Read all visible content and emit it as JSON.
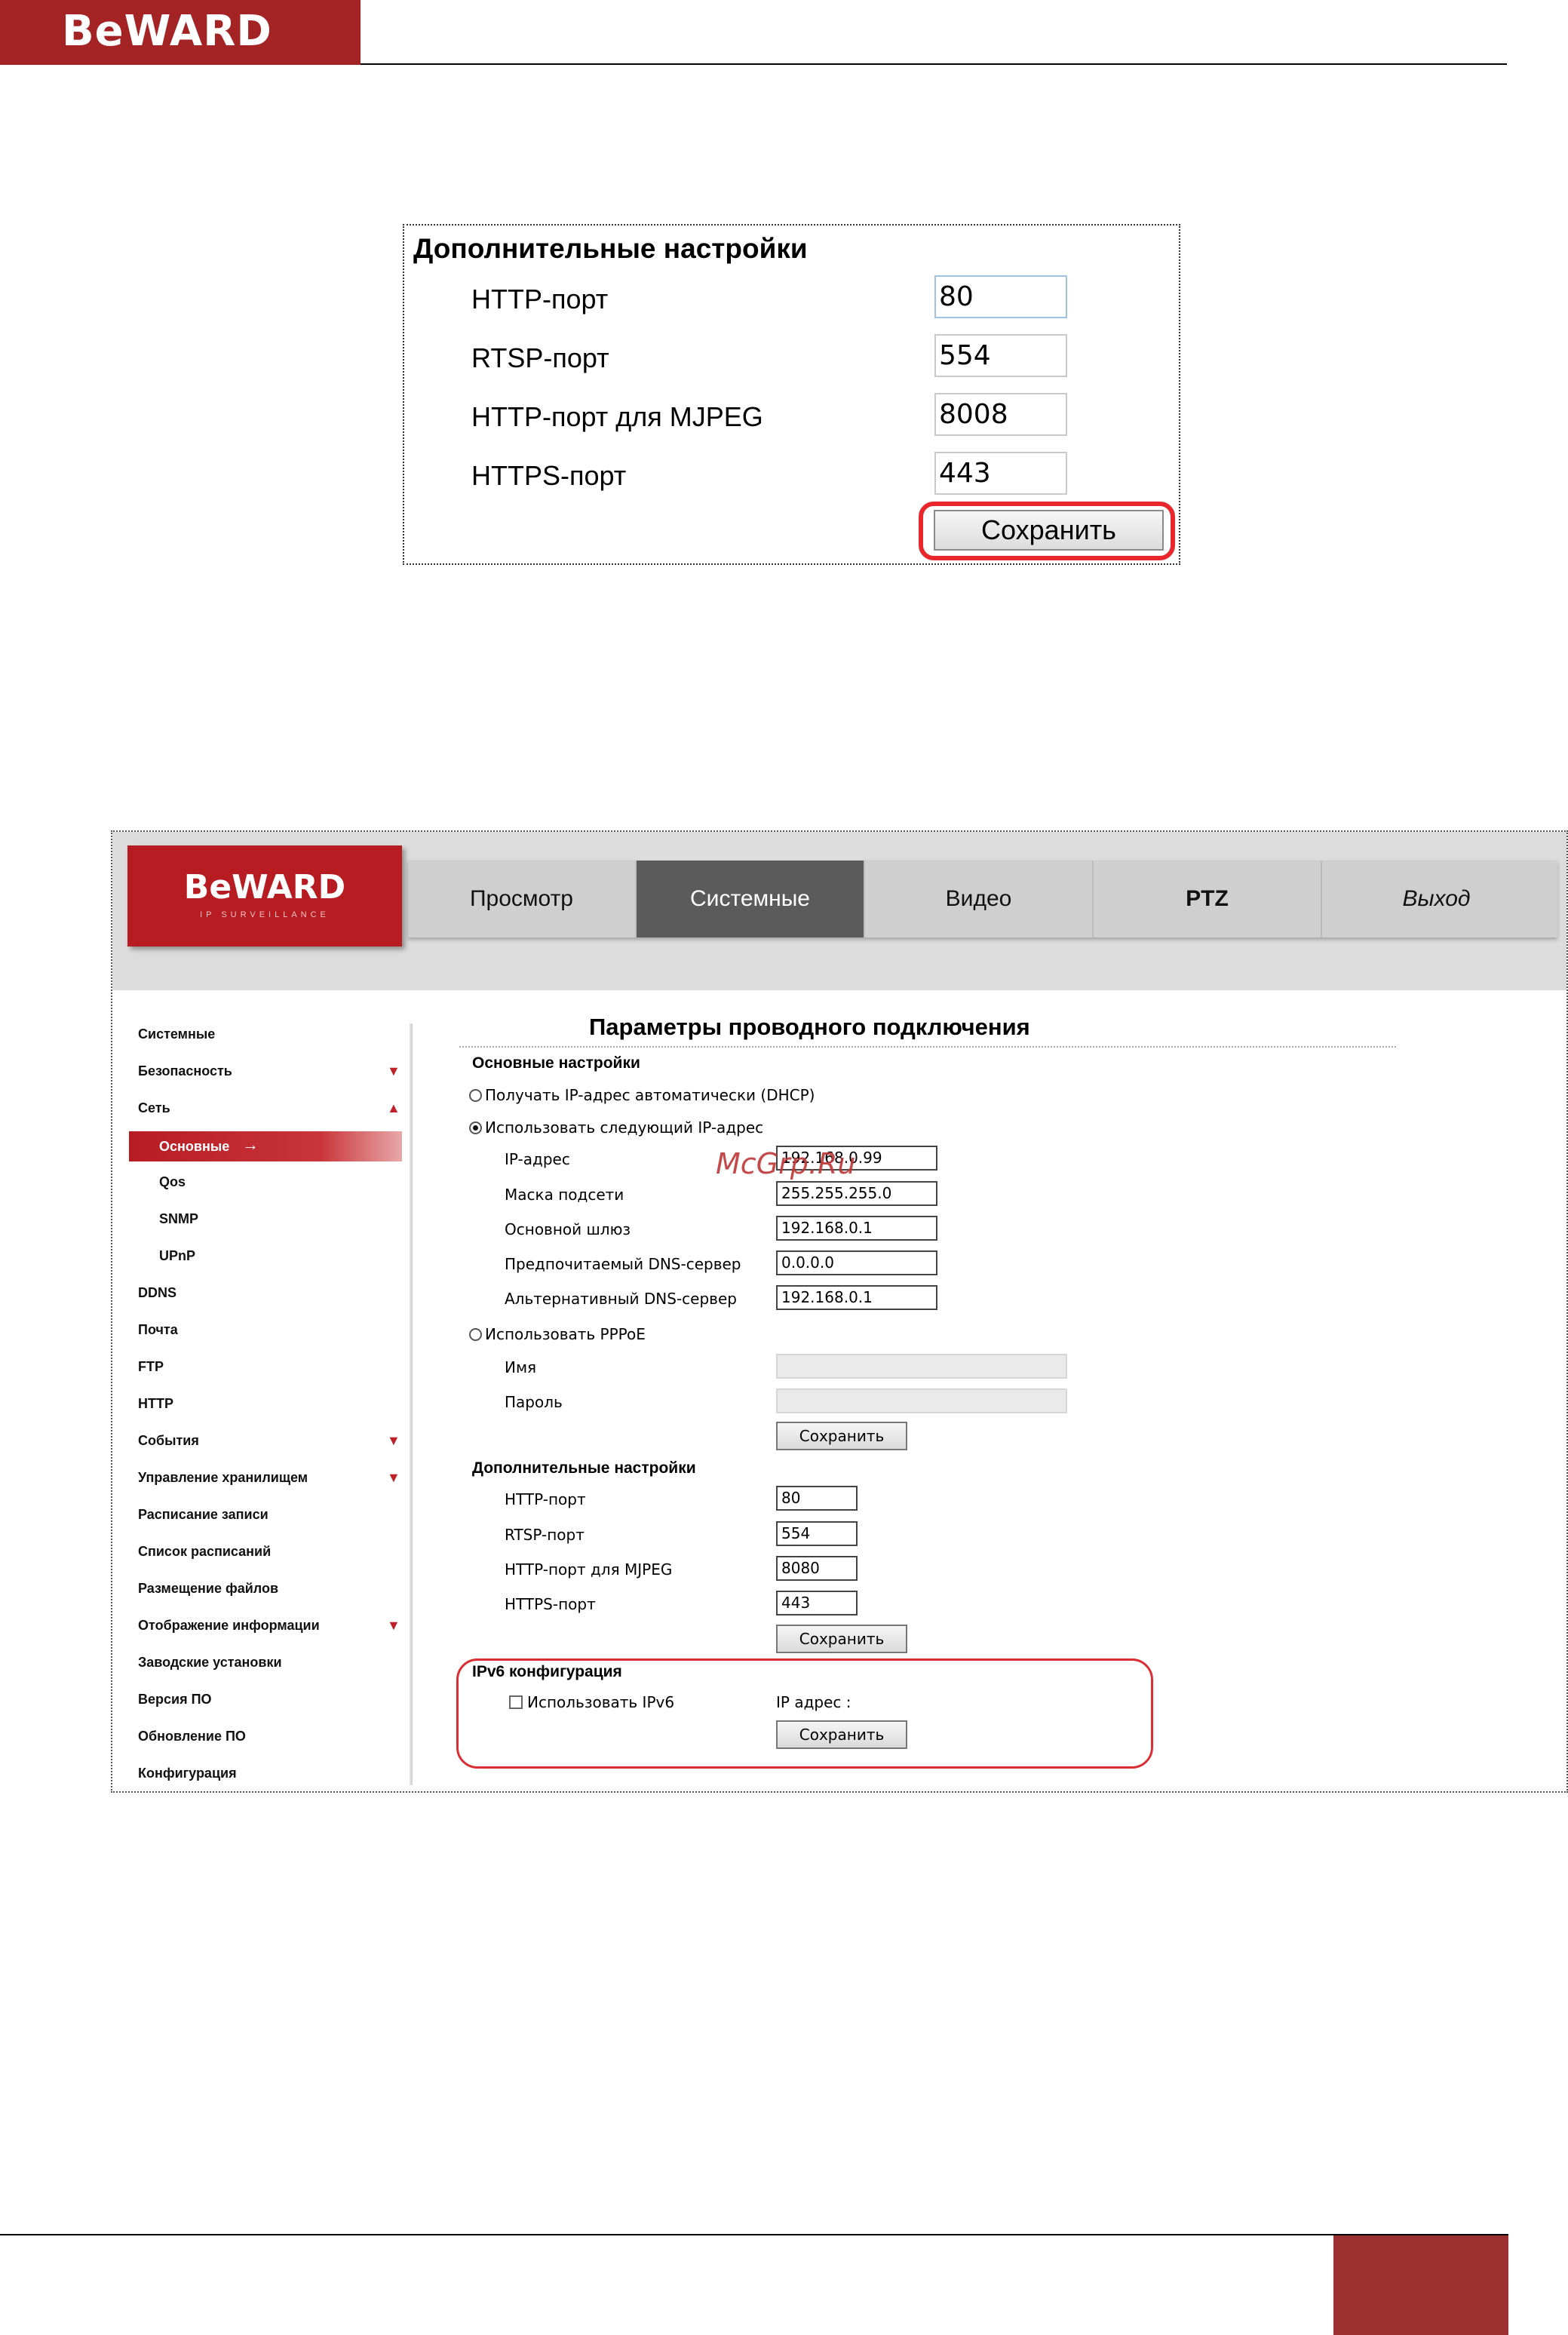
{
  "brand": {
    "logo_text": "BeWARD"
  },
  "zoom": {
    "title": "Дополнительные настройки",
    "fields": [
      {
        "label": "HTTP-порт",
        "value": "80"
      },
      {
        "label": "RTSP-порт",
        "value": "554"
      },
      {
        "label": "HTTP-порт для MJPEG",
        "value": "8008"
      },
      {
        "label": "HTTPS-порт",
        "value": "443"
      }
    ],
    "save_label": "Сохранить",
    "highlight_color": "#e8262b"
  },
  "screenshot": {
    "logo": {
      "text": "BeWARD",
      "subtext": "IP SURVEILLANCE"
    },
    "nav": {
      "tabs": [
        {
          "label": "Просмотр",
          "active": false
        },
        {
          "label": "Системные",
          "active": true
        },
        {
          "label": "Видео",
          "active": false
        },
        {
          "label": "PTZ",
          "active": false
        },
        {
          "label": "Выход",
          "active": false
        }
      ]
    },
    "sidebar": {
      "items": [
        {
          "label": "Системные",
          "arrow": ""
        },
        {
          "label": "Безопасность",
          "arrow": "▼"
        },
        {
          "label": "Сеть",
          "arrow": "▲"
        },
        {
          "label": "Основные",
          "arrow": "",
          "active": true,
          "sub": true
        },
        {
          "label": "Qos",
          "arrow": "",
          "sub": true
        },
        {
          "label": "SNMP",
          "arrow": "",
          "sub": true
        },
        {
          "label": "UPnP",
          "arrow": "",
          "sub": true
        },
        {
          "label": "DDNS",
          "arrow": ""
        },
        {
          "label": "Почта",
          "arrow": ""
        },
        {
          "label": "FTP",
          "arrow": ""
        },
        {
          "label": "HTTP",
          "arrow": ""
        },
        {
          "label": "События",
          "arrow": "▼"
        },
        {
          "label": "Управление хранилищем",
          "arrow": "▼"
        },
        {
          "label": "Расписание записи",
          "arrow": ""
        },
        {
          "label": "Список расписаний",
          "arrow": ""
        },
        {
          "label": "Размещение файлов",
          "arrow": ""
        },
        {
          "label": "Отображение информации",
          "arrow": "▼"
        },
        {
          "label": "Заводские установки",
          "arrow": ""
        },
        {
          "label": "Версия ПО",
          "arrow": ""
        },
        {
          "label": "Обновление ПО",
          "arrow": ""
        },
        {
          "label": "Конфигурация",
          "arrow": ""
        }
      ],
      "active_arrow": "→"
    },
    "main": {
      "title": "Параметры проводного подключения",
      "basic": {
        "title": "Основные настройки",
        "dhcp_label": "Получать IP-адрес автоматически (DHCP)",
        "static_label": "Использовать следующий IP-адрес",
        "fields": [
          {
            "label": "IP-адрес",
            "value": "192.168.0.99"
          },
          {
            "label": "Маска подсети",
            "value": "255.255.255.0"
          },
          {
            "label": "Основной шлюз",
            "value": "192.168.0.1"
          },
          {
            "label": "Предпочитаемый DNS-сервер",
            "value": "0.0.0.0"
          },
          {
            "label": "Альтернативный DNS-сервер",
            "value": "192.168.0.1"
          }
        ],
        "pppoe_label": "Использовать PPPoE",
        "pppoe_fields": [
          {
            "label": "Имя",
            "value": ""
          },
          {
            "label": "Пароль",
            "value": ""
          }
        ],
        "save_label": "Сохранить"
      },
      "advanced": {
        "title": "Дополнительные настройки",
        "fields": [
          {
            "label": "HTTP-порт",
            "value": "80"
          },
          {
            "label": "RTSP-порт",
            "value": "554"
          },
          {
            "label": "HTTP-порт для MJPEG",
            "value": "8080"
          },
          {
            "label": "HTTPS-порт",
            "value": "443"
          }
        ],
        "save_label": "Сохранить"
      },
      "ipv6": {
        "title": "IPv6 конфигурация",
        "checkbox_label": "Использовать IPv6",
        "ip_label": "IP адрес :",
        "save_label": "Сохранить"
      }
    },
    "watermark": "McGrp.Ru"
  }
}
